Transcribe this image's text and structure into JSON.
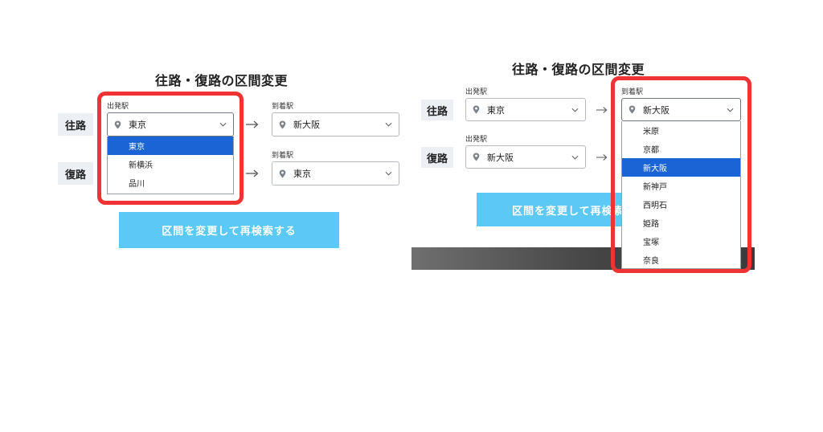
{
  "left_panel": {
    "title": "往路・復路の区間変更",
    "outbound": {
      "label": "往路",
      "from_label": "出発駅",
      "from_value": "東京",
      "to_label": "到着駅",
      "to_value": "新大阪"
    },
    "return": {
      "label": "復路",
      "to_label": "到着駅",
      "to_value": "東京"
    },
    "from_dropdown": {
      "options": [
        "東京",
        "新横浜",
        "品川"
      ],
      "selected": "東京"
    },
    "button_label": "区間を変更して再検索する"
  },
  "right_panel": {
    "title": "往路・復路の区間変更",
    "outbound": {
      "label": "往路",
      "from_label": "出発駅",
      "from_value": "東京",
      "to_label": "到着駅",
      "to_value": "新大阪"
    },
    "return": {
      "label": "復路",
      "from_label": "出発駅",
      "from_value": "新大阪"
    },
    "to_dropdown": {
      "options": [
        "米原",
        "京都",
        "新大阪",
        "新神戸",
        "西明石",
        "姫路",
        "宝塚",
        "奈良"
      ],
      "selected": "新大阪"
    },
    "button_label": "区間を変更して再検索する"
  },
  "colors": {
    "highlight": "#ef3233",
    "selected_option": "#1a64d6",
    "button": "#5bc8f5",
    "row_label_bg": "#eceff3"
  },
  "icons": [
    "location-pin-icon",
    "chevron-down-icon",
    "right-arrow-icon"
  ]
}
